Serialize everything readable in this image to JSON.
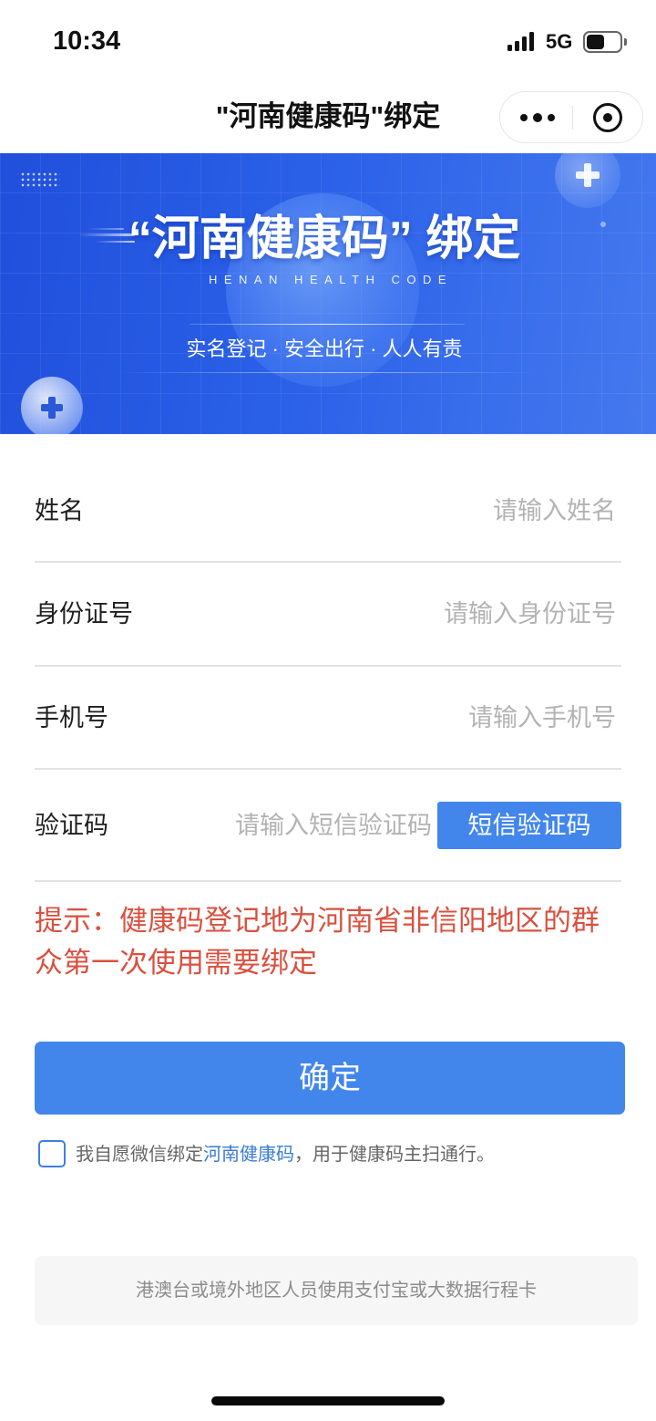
{
  "status_bar": {
    "time": "10:34",
    "network": "5G",
    "signal_bars": 4,
    "battery_level": 0.55,
    "icons": {
      "signal": "signal-icon",
      "battery": "battery-icon"
    }
  },
  "nav": {
    "title": "\"河南健康码\"绑定",
    "icons": {
      "more": "more-dots-icon",
      "close": "capsule-close-icon"
    }
  },
  "banner": {
    "title": "“河南健康码” 绑定",
    "subtitle": "HENAN HEALTH CODE",
    "slogan": "实名登记 · 安全出行 · 人人有责",
    "icons": {
      "decor": "medical-plus-icon"
    }
  },
  "form": {
    "name": {
      "label": "姓名",
      "placeholder": "请输入姓名",
      "value": ""
    },
    "id_number": {
      "label": "身份证号",
      "placeholder": "请输入身份证号",
      "value": ""
    },
    "phone": {
      "label": "手机号",
      "placeholder": "请输入手机号",
      "value": ""
    },
    "sms_code": {
      "label": "验证码",
      "placeholder": "请输入短信验证码",
      "value": "",
      "button_label": "短信验证码"
    }
  },
  "tip": "提示：健康码登记地为河南省非信阳地区的群众第一次使用需要绑定",
  "submit_label": "确定",
  "agreement": {
    "checked": false,
    "prefix": "我自愿微信绑定",
    "link": "河南健康码",
    "suffix": "，用于健康码主扫通行。"
  },
  "footer_note": "港澳台或境外地区人员使用支付宝或大数据行程卡",
  "colors": {
    "banner": "#2a60e8",
    "primary": "#4286ec",
    "tip": "#d9503f",
    "link": "#3a7bd5",
    "checkbox": "#3e7fe0"
  }
}
